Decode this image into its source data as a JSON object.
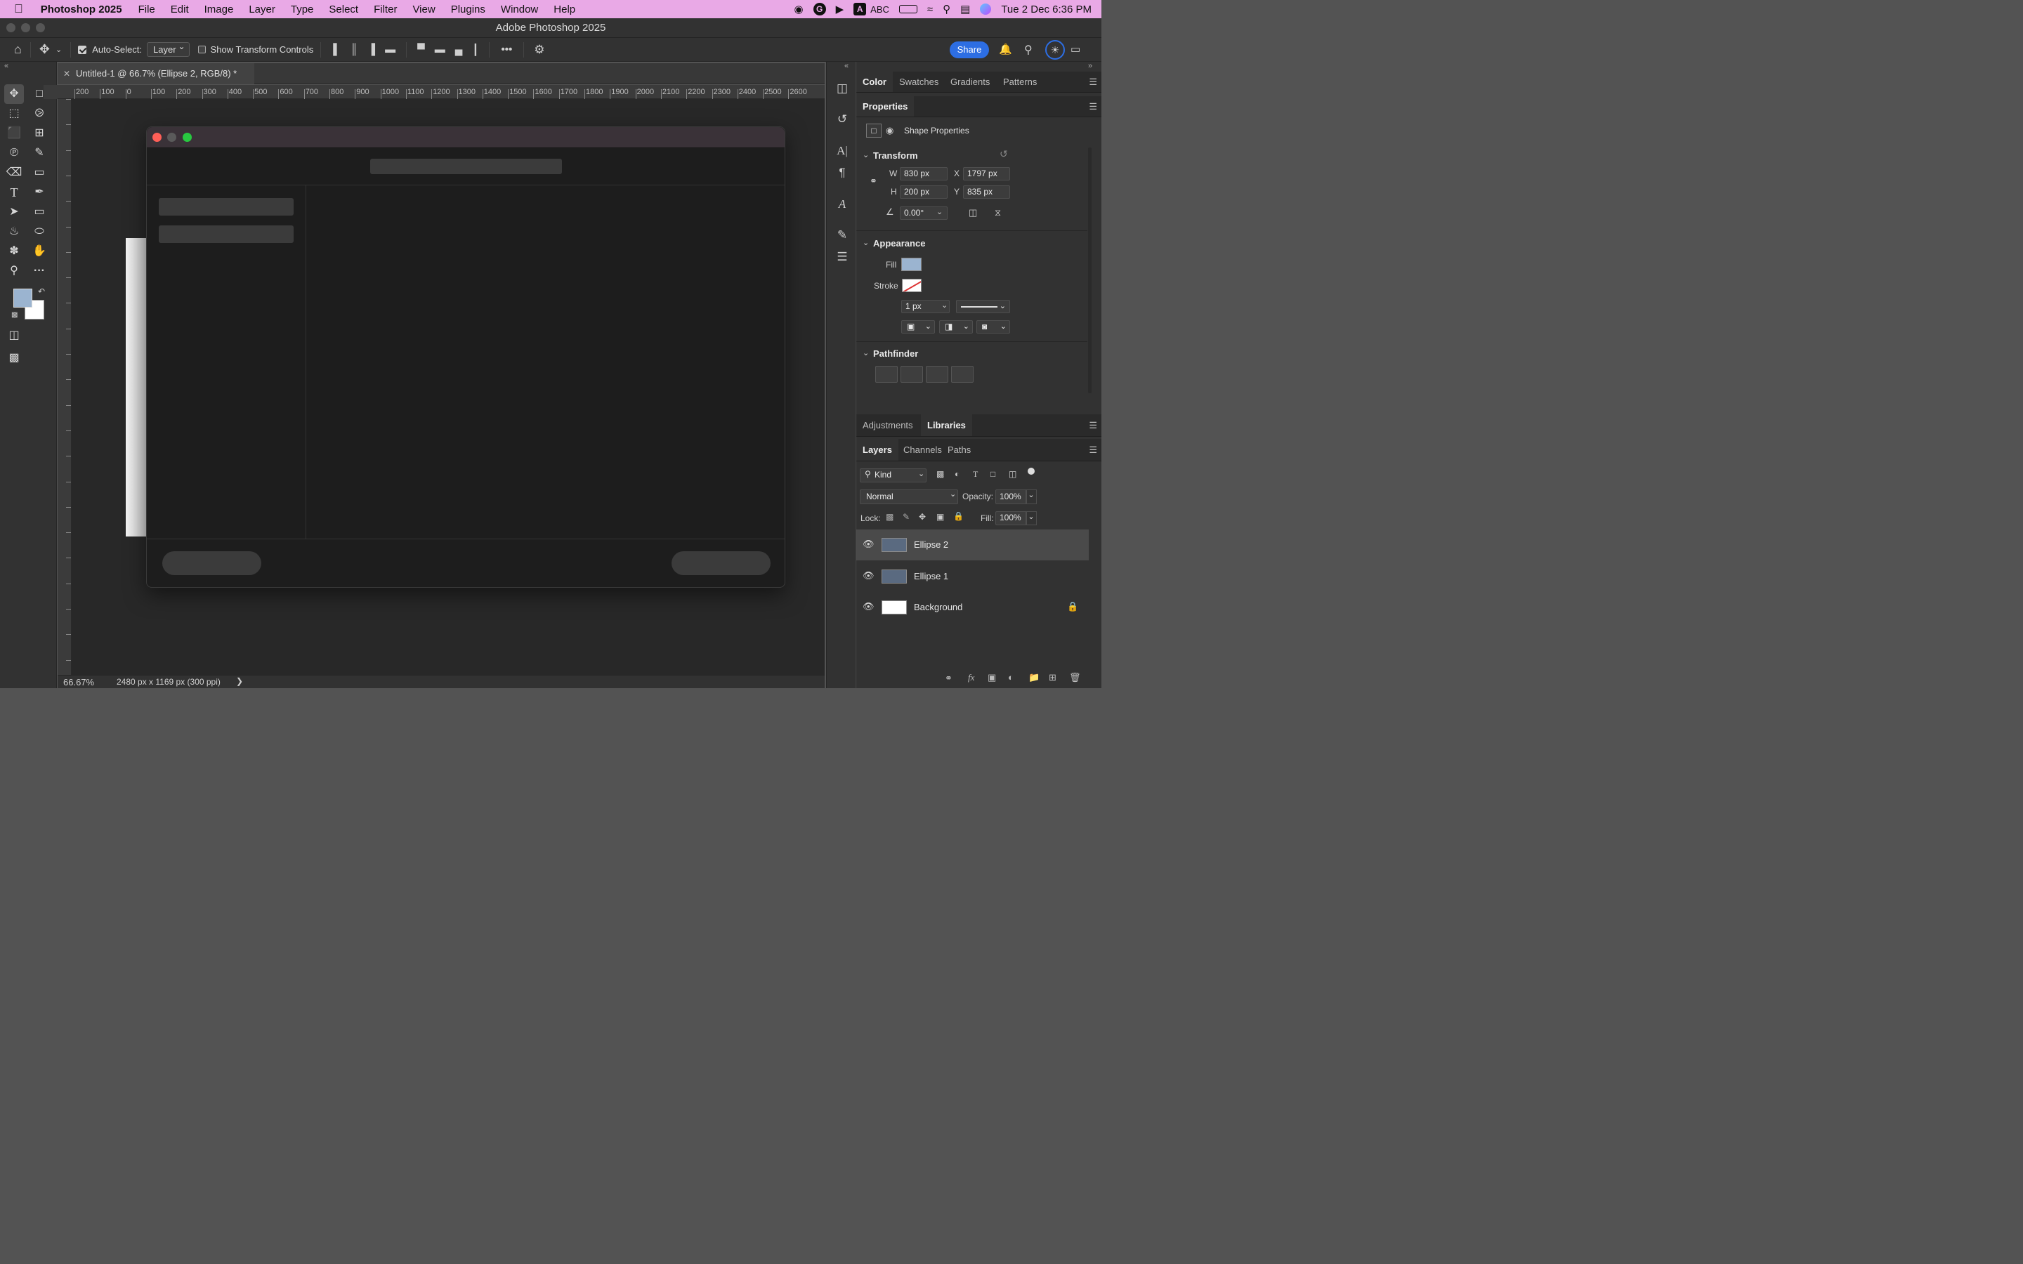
{
  "menubar": {
    "app_name": "Photoshop 2025",
    "items": [
      "File",
      "Edit",
      "Image",
      "Layer",
      "Type",
      "Select",
      "Filter",
      "View",
      "Plugins",
      "Window",
      "Help"
    ],
    "abc_label": "ABC",
    "datetime": "Tue 2 Dec  6:36 PM"
  },
  "window": {
    "title": "Adobe Photoshop 2025"
  },
  "options_bar": {
    "auto_select_label": "Auto-Select:",
    "auto_select_value": "Layer",
    "show_transform_label": "Show Transform Controls",
    "share_label": "Share"
  },
  "document": {
    "tab_title": "Untitled-1 @ 66.7% (Ellipse 2, RGB/8) *",
    "zoom": "66.67%",
    "doc_info": "2480 px x 1169 px (300 ppi)",
    "ruler_ticks": [
      "200",
      "100",
      "0",
      "100",
      "200",
      "300",
      "400",
      "500",
      "600",
      "700",
      "800",
      "900",
      "1000",
      "1100",
      "1200",
      "1300",
      "1400",
      "1500",
      "1600",
      "1700",
      "1800",
      "1900",
      "2000",
      "2100",
      "2200",
      "2300",
      "2400",
      "2500",
      "2600"
    ]
  },
  "panels": {
    "color_tabs": [
      "Color",
      "Swatches",
      "Gradients",
      "Patterns"
    ],
    "properties": {
      "title": "Properties",
      "kind": "Shape Properties",
      "transform_label": "Transform",
      "w_label": "W",
      "w_value": "830 px",
      "h_label": "H",
      "h_value": "200 px",
      "x_label": "X",
      "x_value": "1797 px",
      "y_label": "Y",
      "y_value": "835 px",
      "angle_value": "0.00°",
      "appearance_label": "Appearance",
      "fill_label": "Fill",
      "fill_color": "#9bb4d0",
      "stroke_label": "Stroke",
      "stroke_width": "1 px",
      "pathfinder_label": "Pathfinder"
    },
    "adj_tabs": [
      "Adjustments",
      "Libraries"
    ],
    "layers_tabs": [
      "Layers",
      "Channels",
      "Paths"
    ],
    "layers": {
      "filter_kind": "Kind",
      "blend_mode": "Normal",
      "opacity_label": "Opacity:",
      "opacity_value": "100%",
      "lock_label": "Lock:",
      "fill_label": "Fill:",
      "fill_value": "100%",
      "items": [
        {
          "name": "Ellipse 2",
          "selected": true
        },
        {
          "name": "Ellipse 1",
          "selected": false
        },
        {
          "name": "Background",
          "selected": false
        }
      ]
    }
  },
  "colors": {
    "foreground": "#9bb4d0",
    "background": "#ffffff",
    "share_blue": "#2d6ee3"
  }
}
